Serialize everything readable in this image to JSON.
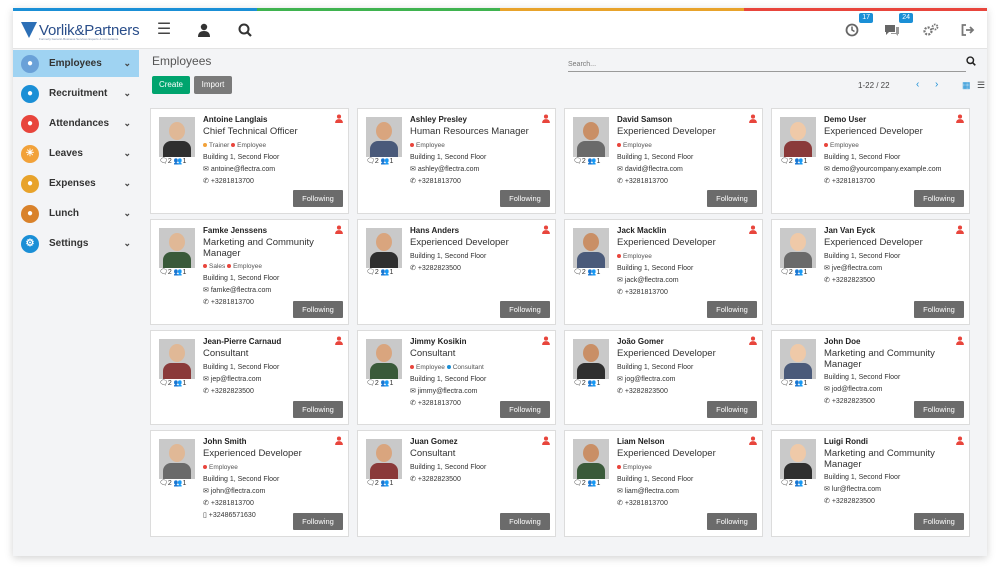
{
  "header": {
    "logo_text": "Vorlik&Partners",
    "logo_subtext": "Formerly Generic-Business Services Experts & Consultants",
    "activity_count": "17",
    "messages_count": "24"
  },
  "colors": {
    "stripe": [
      "#1a8fd6",
      "#3fb34f",
      "#e8a32b",
      "#e8453c"
    ],
    "active_sidebar": "#9fd3f2",
    "create_button": "#00a46e",
    "import_button": "#7a7a7a",
    "follow_button": "#6b6b6b",
    "accent": "#1a8fd6"
  },
  "sidebar": {
    "items": [
      {
        "label": "Employees",
        "icon": "people-tree-icon",
        "color": "#6aa1d8"
      },
      {
        "label": "Recruitment",
        "icon": "recruitment-icon",
        "color": "#1a8fd6"
      },
      {
        "label": "Attendances",
        "icon": "attendance-icon",
        "color": "#e8453c"
      },
      {
        "label": "Leaves",
        "icon": "sun-icon",
        "color": "#f2a23a"
      },
      {
        "label": "Expenses",
        "icon": "expenses-icon",
        "color": "#e8a32b"
      },
      {
        "label": "Lunch",
        "icon": "lunch-icon",
        "color": "#d9822b"
      },
      {
        "label": "Settings",
        "icon": "settings-icon",
        "color": "#1a8fd6"
      }
    ]
  },
  "main": {
    "title": "Employees",
    "search_placeholder": "Search...",
    "create_label": "Create",
    "import_label": "Import",
    "pager": "1-22 / 22"
  },
  "cards": [
    {
      "name": "Antoine Langlais",
      "job": "Chief Technical Officer",
      "tags": [
        {
          "t": "Trainer",
          "c": "#f2a23a"
        },
        {
          "t": "Employee",
          "c": "#e8453c"
        }
      ],
      "lines": [
        "Building 1, Second Floor",
        "antoine@flectra.com",
        "+3281813700"
      ],
      "icons": [
        "building",
        "email",
        "phone"
      ],
      "counts": "2 1",
      "follow": "Following"
    },
    {
      "name": "Ashley Presley",
      "job": "Human Resources Manager",
      "tags": [
        {
          "t": "Employee",
          "c": "#e8453c"
        }
      ],
      "lines": [
        "Building 1, Second Floor",
        "ashley@flectra.com",
        "+3281813700"
      ],
      "icons": [
        "building",
        "email",
        "phone"
      ],
      "counts": "2 1",
      "follow": "Following"
    },
    {
      "name": "David Samson",
      "job": "Experienced Developer",
      "tags": [
        {
          "t": "Employee",
          "c": "#e8453c"
        }
      ],
      "lines": [
        "Building 1, Second Floor",
        "david@flectra.com",
        "+3281813700"
      ],
      "icons": [
        "building",
        "email",
        "phone"
      ],
      "counts": "2 1",
      "follow": "Following"
    },
    {
      "name": "Demo User",
      "job": "Experienced Developer",
      "tags": [
        {
          "t": "Employee",
          "c": "#e8453c"
        }
      ],
      "lines": [
        "Building 1, Second Floor",
        "demo@yourcompany.example.com",
        "+3281813700"
      ],
      "icons": [
        "building",
        "email",
        "phone"
      ],
      "counts": "2 1",
      "follow": "Following"
    },
    {
      "name": "Famke Jenssens",
      "job": "Marketing and Community Manager",
      "tags": [
        {
          "t": "Sales",
          "c": "#e8453c"
        },
        {
          "t": "Employee",
          "c": "#e8453c"
        }
      ],
      "lines": [
        "Building 1, Second Floor",
        "famke@flectra.com",
        "+3281813700"
      ],
      "icons": [
        "building",
        "email",
        "phone"
      ],
      "counts": "2 1",
      "follow": "Following"
    },
    {
      "name": "Hans Anders",
      "job": "Experienced Developer",
      "tags": [],
      "lines": [
        "Building 1, Second Floor",
        "+3282823500"
      ],
      "icons": [
        "building",
        "phone"
      ],
      "counts": "2 1",
      "follow": "Following"
    },
    {
      "name": "Jack Macklin",
      "job": "Experienced Developer",
      "tags": [
        {
          "t": "Employee",
          "c": "#e8453c"
        }
      ],
      "lines": [
        "Building 1, Second Floor",
        "jack@flectra.com",
        "+3281813700"
      ],
      "icons": [
        "building",
        "email",
        "phone"
      ],
      "counts": "2 1",
      "follow": "Following"
    },
    {
      "name": "Jan Van Eyck",
      "job": "Experienced Developer",
      "tags": [],
      "lines": [
        "Building 1, Second Floor",
        "jve@flectra.com",
        "+3282823500"
      ],
      "icons": [
        "building",
        "email",
        "phone"
      ],
      "counts": "2 1",
      "follow": "Following"
    },
    {
      "name": "Jean-Pierre Carnaud",
      "job": "Consultant",
      "tags": [],
      "lines": [
        "Building 1, Second Floor",
        "jep@flectra.com",
        "+3282823500"
      ],
      "icons": [
        "building",
        "email",
        "phone"
      ],
      "counts": "2 1",
      "follow": "Following"
    },
    {
      "name": "Jimmy Kosikin",
      "job": "Consultant",
      "tags": [
        {
          "t": "Employee",
          "c": "#e8453c"
        },
        {
          "t": "Consultant",
          "c": "#1a8fd6"
        }
      ],
      "lines": [
        "Building 1, Second Floor",
        "jimmy@flectra.com",
        "+3281813700"
      ],
      "icons": [
        "building",
        "email",
        "phone"
      ],
      "counts": "2 1",
      "follow": "Following"
    },
    {
      "name": "João Gomer",
      "job": "Experienced Developer",
      "tags": [],
      "lines": [
        "Building 1, Second Floor",
        "jog@flectra.com",
        "+3282823500"
      ],
      "icons": [
        "building",
        "email",
        "phone"
      ],
      "counts": "2 1",
      "follow": "Following"
    },
    {
      "name": "John Doe",
      "job": "Marketing and Community Manager",
      "tags": [],
      "lines": [
        "Building 1, Second Floor",
        "jod@flectra.com",
        "+3282823500"
      ],
      "icons": [
        "building",
        "email",
        "phone"
      ],
      "counts": "2 1",
      "follow": "Following"
    },
    {
      "name": "John Smith",
      "job": "Experienced Developer",
      "tags": [
        {
          "t": "Employee",
          "c": "#e8453c"
        }
      ],
      "lines": [
        "Building 1, Second Floor",
        "john@flectra.com",
        "+3281813700",
        "+32486571630"
      ],
      "icons": [
        "building",
        "email",
        "phone",
        "mobile"
      ],
      "counts": "2 1",
      "follow": "Following"
    },
    {
      "name": "Juan Gomez",
      "job": "Consultant",
      "tags": [],
      "lines": [
        "Building 1, Second Floor",
        "+3282823500"
      ],
      "icons": [
        "building",
        "phone"
      ],
      "counts": "2 1",
      "follow": "Following"
    },
    {
      "name": "Liam Nelson",
      "job": "Experienced Developer",
      "tags": [
        {
          "t": "Employee",
          "c": "#e8453c"
        }
      ],
      "lines": [
        "Building 1, Second Floor",
        "liam@flectra.com",
        "+3281813700"
      ],
      "icons": [
        "building",
        "email",
        "phone"
      ],
      "counts": "2 1",
      "follow": "Following"
    },
    {
      "name": "Luigi Rondi",
      "job": "Marketing and Community Manager",
      "tags": [],
      "lines": [
        "Building 1, Second Floor",
        "lur@flectra.com",
        "+3282823500"
      ],
      "icons": [
        "building",
        "email",
        "phone"
      ],
      "counts": "2 1",
      "follow": "Following"
    }
  ]
}
